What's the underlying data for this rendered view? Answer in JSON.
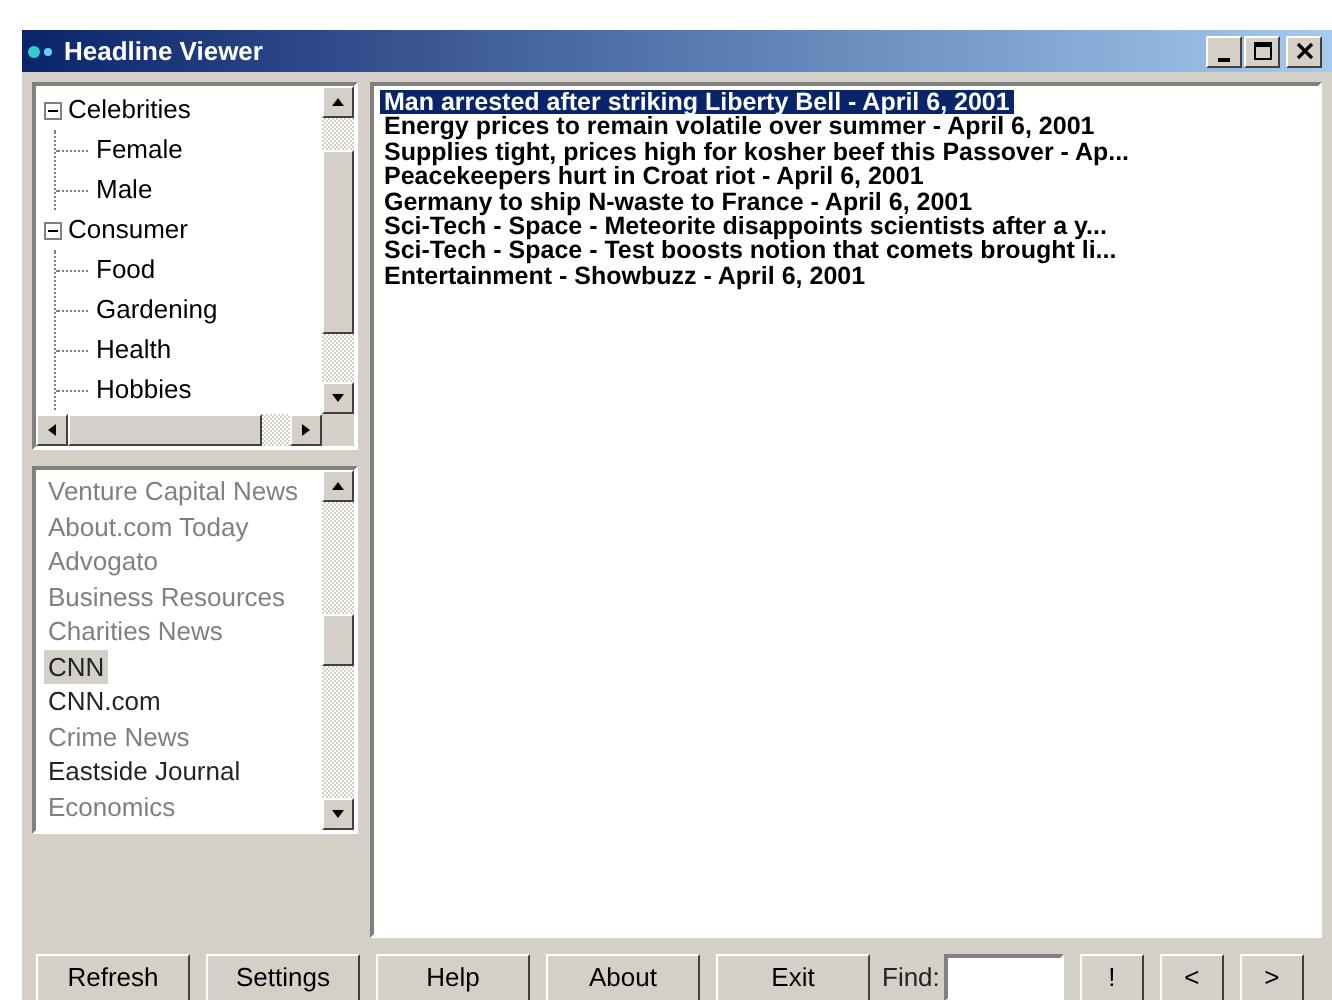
{
  "window": {
    "title": "Headline Viewer"
  },
  "categories": [
    {
      "label": "Celebrities",
      "expanded": true,
      "children": [
        {
          "label": "Female"
        },
        {
          "label": "Male"
        }
      ]
    },
    {
      "label": "Consumer",
      "expanded": true,
      "children": [
        {
          "label": "Food"
        },
        {
          "label": "Gardening"
        },
        {
          "label": "Health"
        },
        {
          "label": "Hobbies"
        }
      ]
    }
  ],
  "channels": [
    {
      "label": "Venture Capital News",
      "subscribed": false,
      "selected": false
    },
    {
      "label": "About.com Today",
      "subscribed": false,
      "selected": false
    },
    {
      "label": "Advogato",
      "subscribed": false,
      "selected": false
    },
    {
      "label": "Business Resources",
      "subscribed": false,
      "selected": false
    },
    {
      "label": "Charities News",
      "subscribed": false,
      "selected": false
    },
    {
      "label": "CNN",
      "subscribed": true,
      "selected": true
    },
    {
      "label": "CNN.com",
      "subscribed": true,
      "selected": false
    },
    {
      "label": "Crime News",
      "subscribed": false,
      "selected": false
    },
    {
      "label": "Eastside Journal",
      "subscribed": true,
      "selected": false
    },
    {
      "label": "Economics",
      "subscribed": false,
      "selected": false
    }
  ],
  "headlines": [
    {
      "text": "Man arrested after striking Liberty Bell - April  6, 2001",
      "selected": true
    },
    {
      "text": "Energy prices to remain volatile over summer - April  6, 2001",
      "selected": false
    },
    {
      "text": "Supplies tight, prices high for kosher beef this Passover - Ap...",
      "selected": false
    },
    {
      "text": "Peacekeepers hurt in Croat riot - April  6, 2001",
      "selected": false
    },
    {
      "text": "Germany to ship N-waste to France - April  6, 2001",
      "selected": false
    },
    {
      "text": "Sci-Tech - Space - Meteorite disappoints scientists after a y...",
      "selected": false
    },
    {
      "text": "Sci-Tech - Space - Test boosts notion that comets brought li...",
      "selected": false
    },
    {
      "text": "Entertainment - Showbuzz - April  6, 2001",
      "selected": false
    }
  ],
  "buttons": [
    "Refresh",
    "Settings",
    "Help",
    "About",
    "Exit"
  ],
  "find": {
    "label": "Find:"
  },
  "nav_buttons": [
    "!",
    "<",
    ">"
  ]
}
